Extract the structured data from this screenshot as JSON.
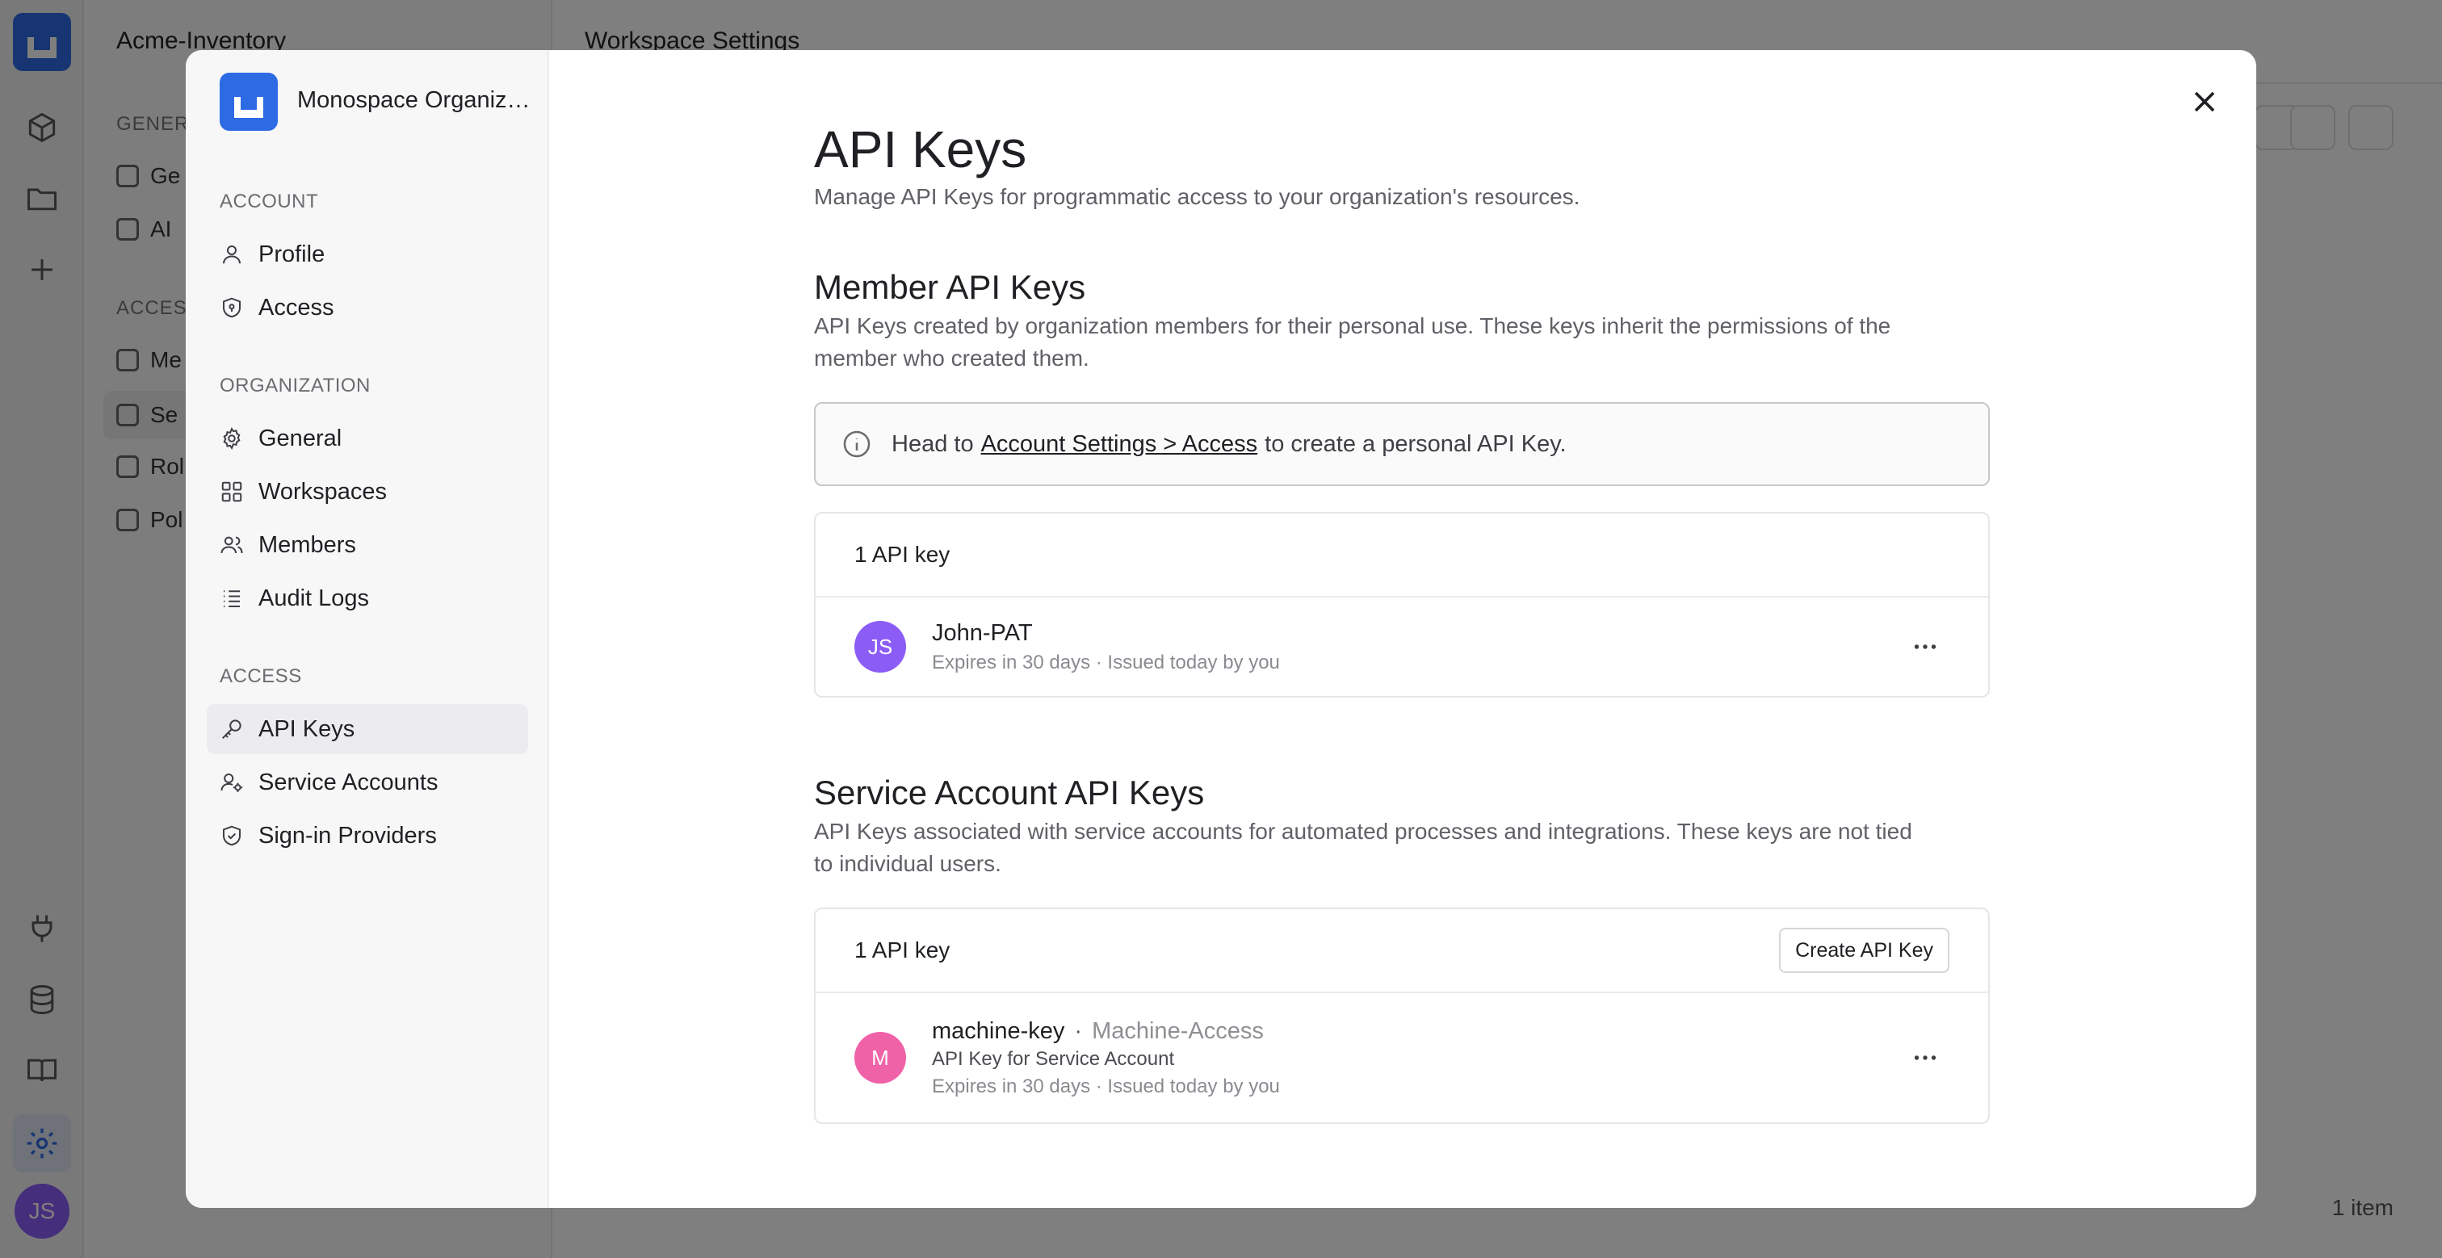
{
  "background": {
    "workspace_name": "Acme-Inventory",
    "page_title": "Workspace Settings",
    "nav_sections": [
      "GENERA",
      "ACCESS"
    ],
    "nav_items": [
      "Ge",
      "AI",
      "Me",
      "Se",
      "Rol",
      "Pol"
    ],
    "footer_count": "1 item",
    "user_initials": "JS"
  },
  "modal": {
    "org_name": "Monospace Organization",
    "sidebar": {
      "sections": [
        {
          "label": "ACCOUNT",
          "items": [
            {
              "label": "Profile",
              "icon": "user-icon"
            },
            {
              "label": "Access",
              "icon": "shield-lock-icon"
            }
          ]
        },
        {
          "label": "ORGANIZATION",
          "items": [
            {
              "label": "General",
              "icon": "gear-icon"
            },
            {
              "label": "Workspaces",
              "icon": "grid-icon"
            },
            {
              "label": "Members",
              "icon": "users-icon"
            },
            {
              "label": "Audit Logs",
              "icon": "list-icon"
            }
          ]
        },
        {
          "label": "ACCESS",
          "items": [
            {
              "label": "API Keys",
              "icon": "key-icon"
            },
            {
              "label": "Service Accounts",
              "icon": "service-account-icon"
            },
            {
              "label": "Sign-in Providers",
              "icon": "shield-check-icon"
            }
          ]
        }
      ],
      "active_item": "API Keys"
    },
    "page_title": "API Keys",
    "page_subtitle": "Manage API Keys for programmatic access to your organization's resources.",
    "member_section": {
      "title": "Member API Keys",
      "description": "API Keys created by organization members for their personal use. These keys inherit the permissions of the member who created them.",
      "callout_prefix": "Head to",
      "callout_link": "Account Settings > Access",
      "callout_suffix": "to create a personal API Key.",
      "count_label": "1 API key",
      "keys": [
        {
          "initials": "JS",
          "avatar_color": "#8b5cf6",
          "name": "John-PAT",
          "meta": "Expires in 30 days · Issued today by you"
        }
      ]
    },
    "service_section": {
      "title": "Service Account API Keys",
      "description": "API Keys associated with service accounts for automated processes and integrations. These keys are not tied to individual users.",
      "count_label": "1 API key",
      "create_button": "Create API Key",
      "keys": [
        {
          "initials": "M",
          "avatar_color": "#f062a8",
          "name": "machine-key",
          "separator": "·",
          "account": "Machine-Access",
          "description": "API Key for Service Account",
          "meta": "Expires in 30 days · Issued today by you"
        }
      ]
    }
  },
  "colors": {
    "brand": "#2d6be5",
    "overlay": "rgba(0,0,0,0.5)"
  }
}
